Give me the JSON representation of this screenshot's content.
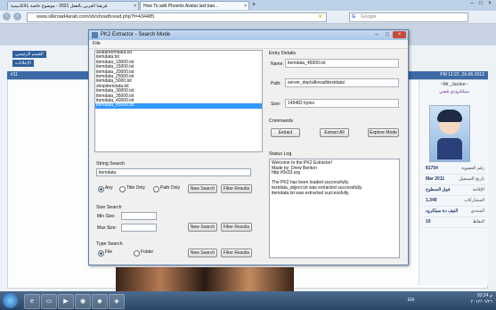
{
  "browser": {
    "tabs": [
      {
        "title": "فريقنا العربي بالفعل 2021 - موضوع خاصة بالاكاديمية"
      },
      {
        "title": "How To add Phoenix Avatar last ban..."
      }
    ],
    "url": "www.silkroad4arab.com/vb/showthread.php?t=434485",
    "search_placeholder": "Google",
    "new_tab": "+"
  },
  "forum": {
    "top_buttons": [
      "القسم الرئيسي",
      "الإعلانات"
    ],
    "post_bar_left": "#11",
    "post_bar_right": "PM 12:22 ,26-06-2012",
    "username": "~Mr_Jackie~",
    "user_title": "سيلكرودي فضي",
    "stats": [
      {
        "value": "81754",
        "key": "رقم العضوية"
      },
      {
        "value": "Mar 2011",
        "key": "تاريخ التسجيل"
      },
      {
        "value": "فوق السطوح",
        "key": "الإقامة"
      },
      {
        "value": "1,349",
        "key": "المشاركات"
      },
      {
        "value": "النيف دة سيلكرود",
        "key": "المنتدي"
      },
      {
        "value": "10",
        "key": "النقاط"
      }
    ]
  },
  "app": {
    "title": "PK2 Extractor - Search Mode",
    "menu": [
      "File"
    ],
    "files": [
      "avatarItemdata.txt",
      "itemdata.txt",
      "itemdata_10000.txt",
      "itemdata_15000.txt",
      "itemdata_20000.txt",
      "itemdata_25000.txt",
      "itemdata_5000.txt",
      "shopitemdata.txt",
      "itemdata_30000.txt",
      "itemdata_35000.txt",
      "itemdata_40000.txt",
      "itemdata_45000.txt"
    ],
    "selected_file_index": 11,
    "string_search": {
      "label": "String Search",
      "value": "itemdata",
      "options": [
        "Any",
        "Title Only",
        "Path Only"
      ],
      "selected": "Any",
      "new_search": "New Search",
      "filter": "Filter Results"
    },
    "size_search": {
      "label": "Size Search",
      "min_label": "Min Size:",
      "max_label": "Max Size:",
      "min_value": "",
      "max_value": "",
      "new_search": "New Search",
      "filter": "Filter Results"
    },
    "type_search": {
      "label": "Type Search",
      "options": [
        "File",
        "Folder"
      ],
      "selected": "File",
      "new_search": "New Search",
      "filter": "Filter Results"
    },
    "entry": {
      "label": "Entry Details",
      "name_label": "Name:",
      "name": "itemdata_45000.txt",
      "path_label": "Path:",
      "path": "server_dep\\silkroad\\textdata\\",
      "size_label": "Size:",
      "size": "149482 bytes"
    },
    "commands": {
      "label": "Commands",
      "extract": "Extract",
      "extract_all": "Extract All",
      "explore": "Explore Mode"
    },
    "status": {
      "label": "Status Log",
      "lines": [
        "Welcome to the PK2 Extractor!",
        "Made by: Drew Benton",
        "http://0x33.org",
        "",
        "The PK2 has been loaded successfully.",
        "textdata_object.txt was extracted successfully.",
        "itemdata.txt was extracted successfully."
      ]
    }
  },
  "taskbar": {
    "lang": "EN",
    "time": "02:24 م",
    "date": "٢٠١٢/٠٦/٢٦"
  }
}
